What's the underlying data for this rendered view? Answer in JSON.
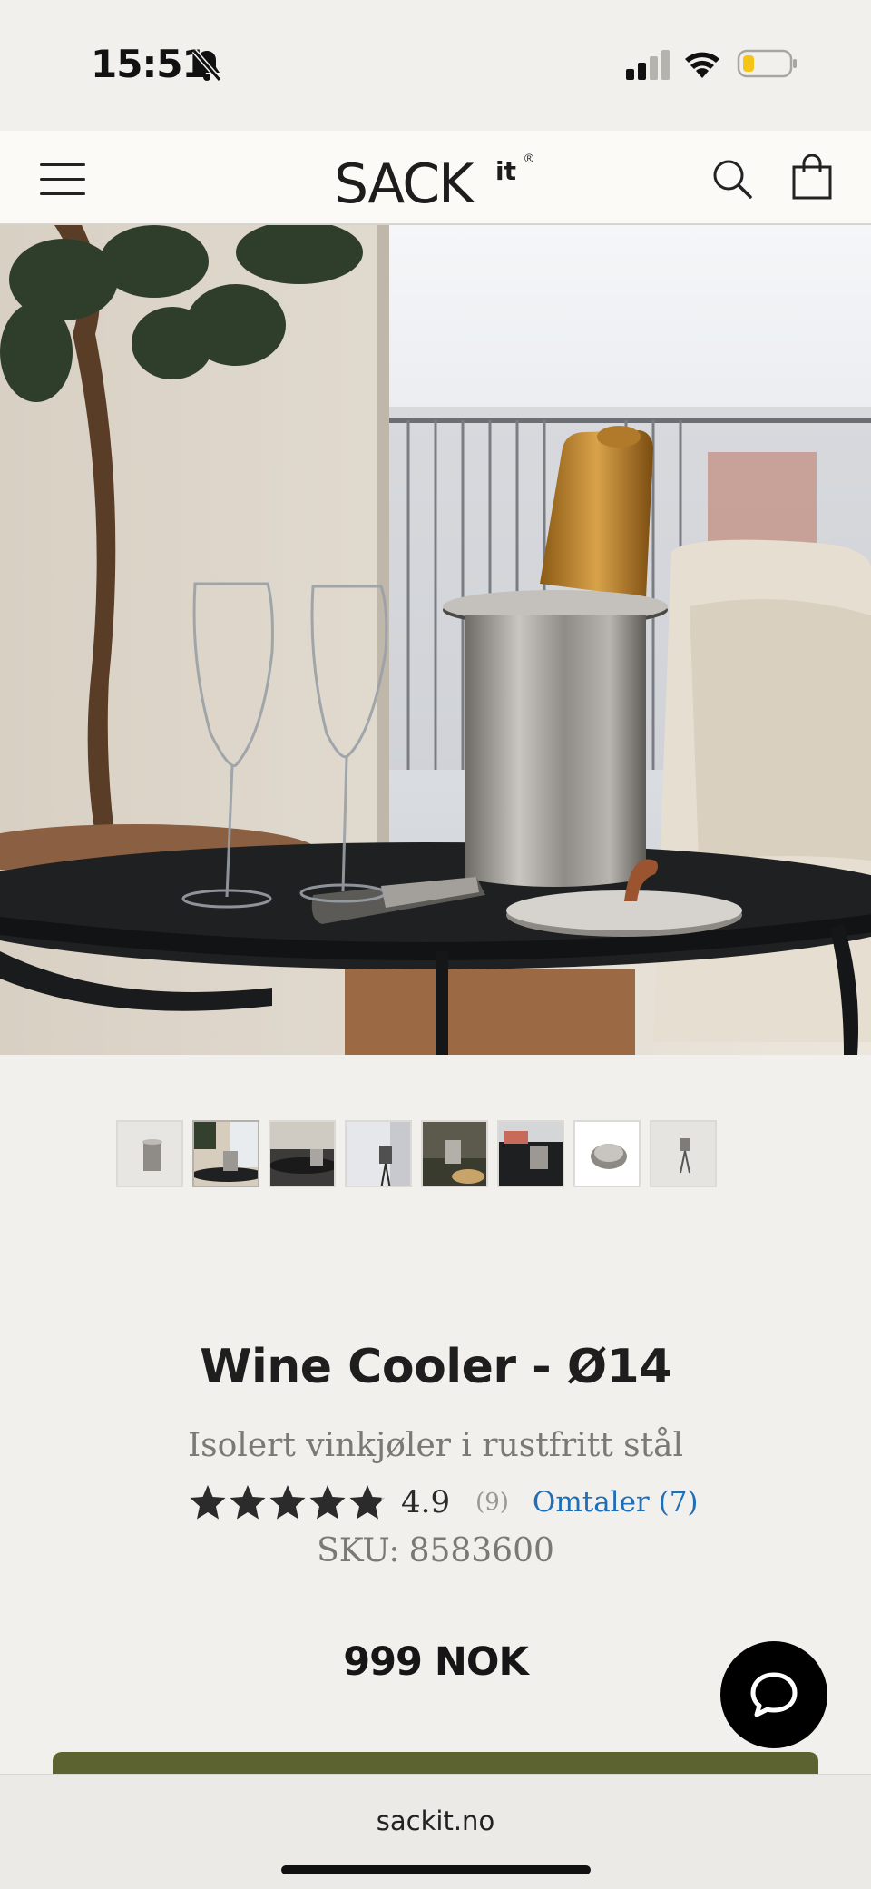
{
  "status_bar": {
    "time": "15:51",
    "icons": [
      "bell-slash-icon",
      "cellular-signal-icon",
      "wifi-icon",
      "battery-low-icon"
    ]
  },
  "header": {
    "logo_main": "SACK",
    "logo_sup": "it",
    "logo_reg": "®",
    "icons": [
      "menu-icon",
      "search-icon",
      "shopping-bag-icon"
    ]
  },
  "gallery": {
    "thumbnail_count": 8,
    "active_index": 1
  },
  "product": {
    "title": "Wine Cooler - Ø14",
    "subtitle": "Isolert vinkjøler i rustfritt stål",
    "rating": "4.9",
    "rating_fraction": 0.98,
    "rating_count": "(9)",
    "reviews_link": "Omtaler (7)",
    "sku_label": "SKU:",
    "sku_value": "8583600",
    "price": "999 NOK"
  },
  "chat": {
    "icon": "chat-bubble-icon"
  },
  "browser": {
    "url": "sackit.no"
  },
  "colors": {
    "background": "#f1f0ed",
    "link": "#1f6fb8",
    "cta": "#5c6330",
    "star": "#2b2b2b"
  }
}
